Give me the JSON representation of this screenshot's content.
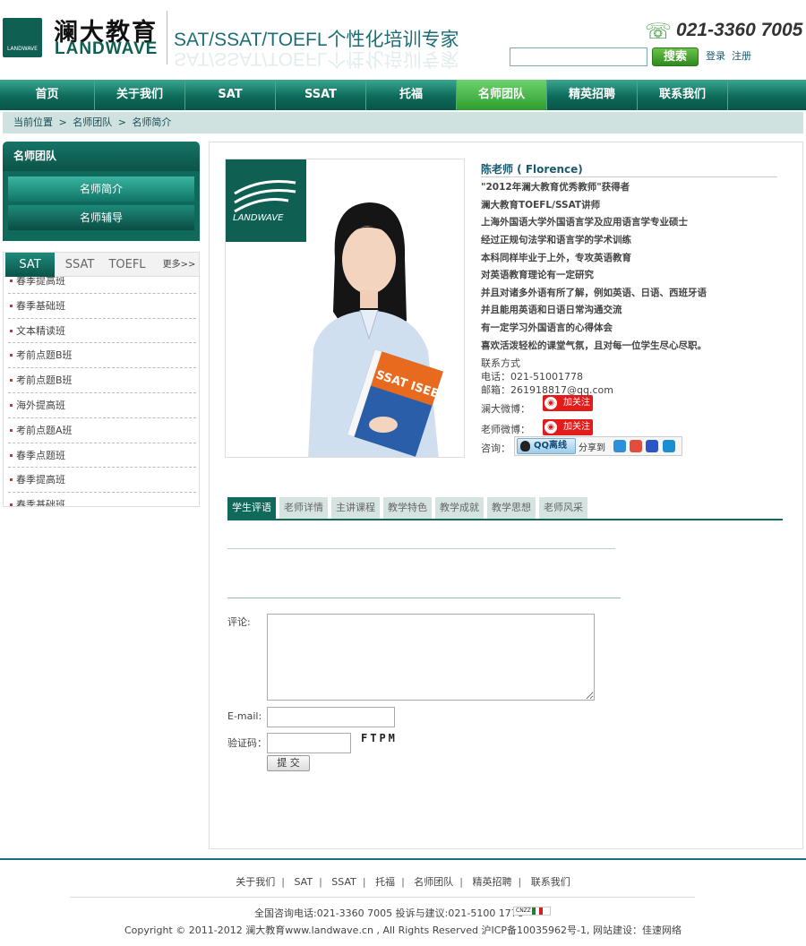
{
  "header": {
    "logo_text_cn": "澜大教育",
    "logo_text_en": "LANDWAVE",
    "logo_mark_text": "LANDWAVE",
    "slogan": "SAT/SSAT/TOEFL个性化培训专家",
    "phone": "021-3360 7005",
    "search_placeholder": "",
    "search_button": "搜索",
    "login": "登录",
    "register": "注册"
  },
  "nav": {
    "items": [
      "首页",
      "关于我们",
      "SAT",
      "SSAT",
      "托福",
      "名师团队",
      "精英招聘",
      "联系我们"
    ],
    "active": "名师团队"
  },
  "breadcrumb": {
    "items": [
      "当前位置",
      ">",
      "名师团队",
      ">",
      "名师简介"
    ]
  },
  "sidebar": {
    "title": "名师团队",
    "buttons": [
      "名师简介",
      "名师辅导"
    ],
    "tabs": [
      "SAT",
      "SSAT",
      "TOEFL",
      "更多>>"
    ],
    "courses": [
      "春季提高班",
      "春季基础班",
      "文本精读班",
      "考前点题B班",
      "考前点题B班",
      "海外提高班",
      "考前点题A班",
      "春季点题班",
      "春季提高班",
      "春季基础班"
    ]
  },
  "teacher": {
    "name": "陈老师 ( Florence)",
    "bio": [
      "\"2012年澜大教育优秀教师\"获得者",
      "澜大教育TOEFL/SSAT讲师",
      "上海外国语大学外国语言学及应用语言学专业硕士",
      "经过正规句法学和语言学的学术训练",
      "本科同样毕业于上外，专攻英语教育",
      "对英语教育理论有一定研究",
      "并且对诸多外语有所了解，例如英语、日语、西班牙语",
      "并且能用英语和日语日常沟通交流",
      "有一定学习外国语言的心得体会",
      "喜欢活泼轻松的课堂气氛，且对每一位学生尽心尽职。"
    ],
    "contact_title": "联系方式",
    "phone": "电话：021-51001778",
    "email": "邮箱：261918817@qq.com",
    "weibo_school_label": "澜大微博：",
    "weibo_teacher_label": "老师微博：",
    "follow_label": "加关注",
    "consult_label": "咨询：",
    "qq_label": "QQ离线",
    "share_label": "分享到",
    "photo_badge": "LANDWAVE",
    "book_text": "SSAT ISEE"
  },
  "tabs": {
    "items": [
      "学生评语",
      "老师详情",
      "主讲课程",
      "教学特色",
      "教学成就",
      "教学思想",
      "老师风采"
    ],
    "active": "学生评语"
  },
  "form": {
    "comment_label": "评论:",
    "email_label": "E-mail:",
    "code_label": "验证码：",
    "captcha": "FTPM",
    "submit": "提 交"
  },
  "footer": {
    "links": [
      "关于我们",
      "SAT",
      "SSAT",
      "托福",
      "名师团队",
      "精英招聘",
      "联系我们"
    ],
    "contact": "全国咨询电话:021-3360 7005   投诉与建议:021-5100 1778",
    "badge": "CNZZ",
    "copyright": "Copyright © 2011-2012 澜大教育www.landwave.cn , All Rights Reserved 沪ICP备10035962号-1, 网站建设：佳速网络"
  },
  "colors": {
    "brand_green": "#0f6a5c",
    "nav_active": "#3fb23f",
    "follow_red": "#e21b1b"
  }
}
